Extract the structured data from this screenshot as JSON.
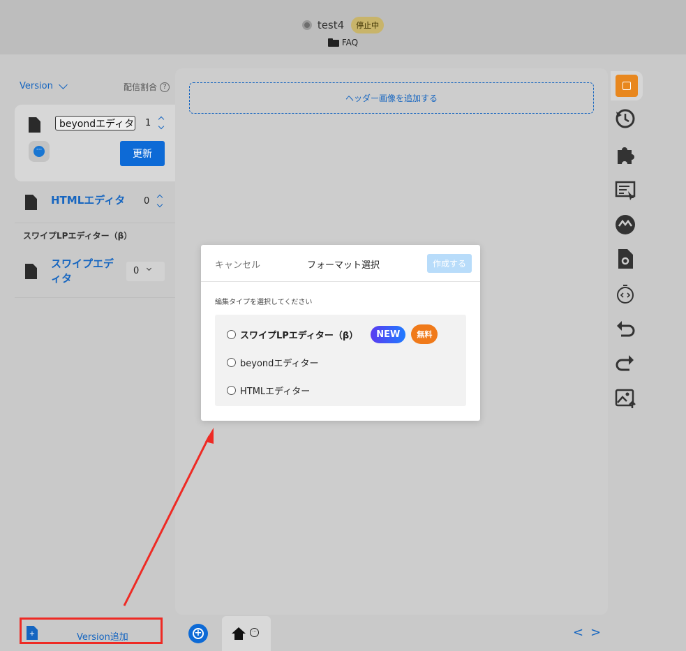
{
  "header": {
    "project_name": "test4",
    "status": "停止中",
    "folder": "FAQ"
  },
  "sidebar": {
    "version_label": "Version",
    "ratio_label": "配信割合",
    "help": "?",
    "active_version": {
      "name": "beyondエディター",
      "ratio": "1",
      "update_label": "更新",
      "more": "···"
    },
    "html_version": {
      "label": "HTMLエディタ",
      "ratio": "0"
    },
    "swipe_section": "スワイプLPエディター（β）",
    "swipe_version": {
      "label": "スワイプエディタ",
      "ratio": "0"
    }
  },
  "bottom": {
    "add_version_label": "Version追加",
    "add_doc": "+",
    "plus": "+",
    "dots": "···",
    "prev": "<",
    "next": ">"
  },
  "canvas": {
    "header_image_label": "ヘッダー画像を追加する"
  },
  "toolbar": {
    "icons": [
      "open-external-icon",
      "history-icon",
      "puzzle-icon",
      "edit-text-icon",
      "ab-icon",
      "file-settings-icon",
      "stopwatch-code-icon",
      "undo-icon",
      "redo-icon",
      "image-upload-icon"
    ],
    "accent": "#e8871e"
  },
  "dialog": {
    "cancel": "キャンセル",
    "title": "フォーマット選択",
    "create": "作成する",
    "subtitle": "編集タイプを選択してください",
    "options": [
      {
        "label": "スワイプLPエディター（β）",
        "badge_new": "NEW",
        "badge_free": "無料"
      },
      {
        "label": "beyondエディター"
      },
      {
        "label": "HTMLエディター"
      }
    ]
  },
  "colors": {
    "primary": "#0d6ad6",
    "annotation": "#ee2a24"
  }
}
